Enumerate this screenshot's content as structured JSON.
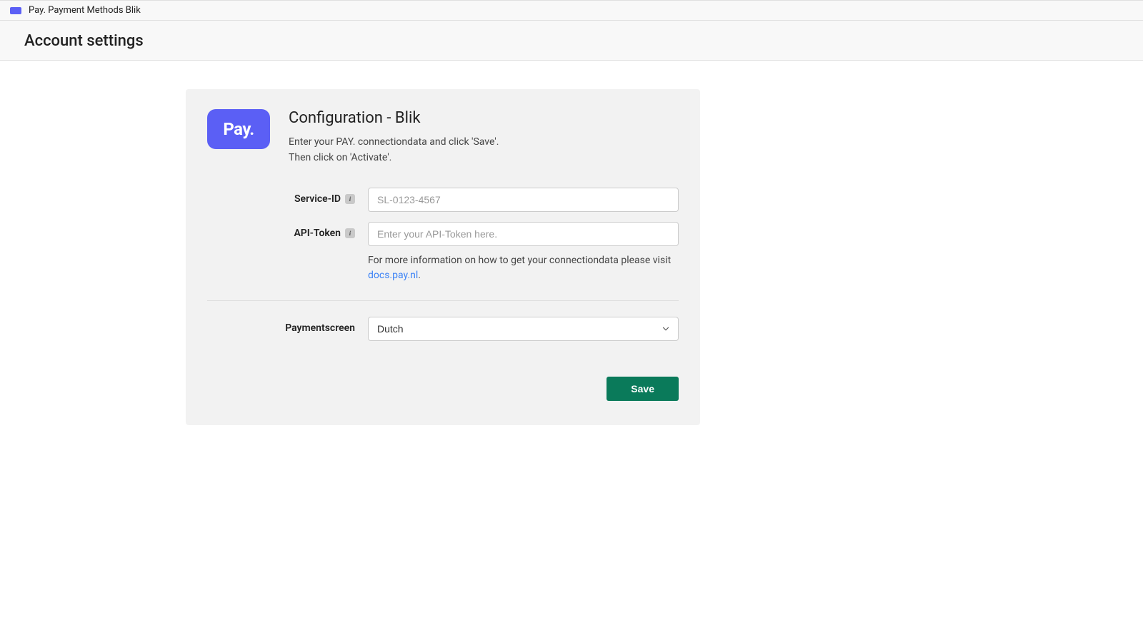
{
  "topbar": {
    "icon_label": "Pay",
    "title": "Pay. Payment Methods Blik"
  },
  "header": {
    "title": "Account settings"
  },
  "card": {
    "logo_text": "Pay.",
    "title": "Configuration - Blik",
    "desc_line1": "Enter your PAY. connectiondata and click 'Save'.",
    "desc_line2": "Then click on 'Activate'."
  },
  "form": {
    "service_id": {
      "label": "Service-ID",
      "placeholder": "SL-0123-4567",
      "value": ""
    },
    "api_token": {
      "label": "API-Token",
      "placeholder": "Enter your API-Token here.",
      "value": ""
    },
    "help": {
      "text": "For more information on how to get your connectiondata please visit ",
      "link_text": "docs.pay.nl",
      "suffix": "."
    },
    "paymentscreen": {
      "label": "Paymentscreen",
      "selected": "Dutch"
    }
  },
  "actions": {
    "save": "Save"
  }
}
